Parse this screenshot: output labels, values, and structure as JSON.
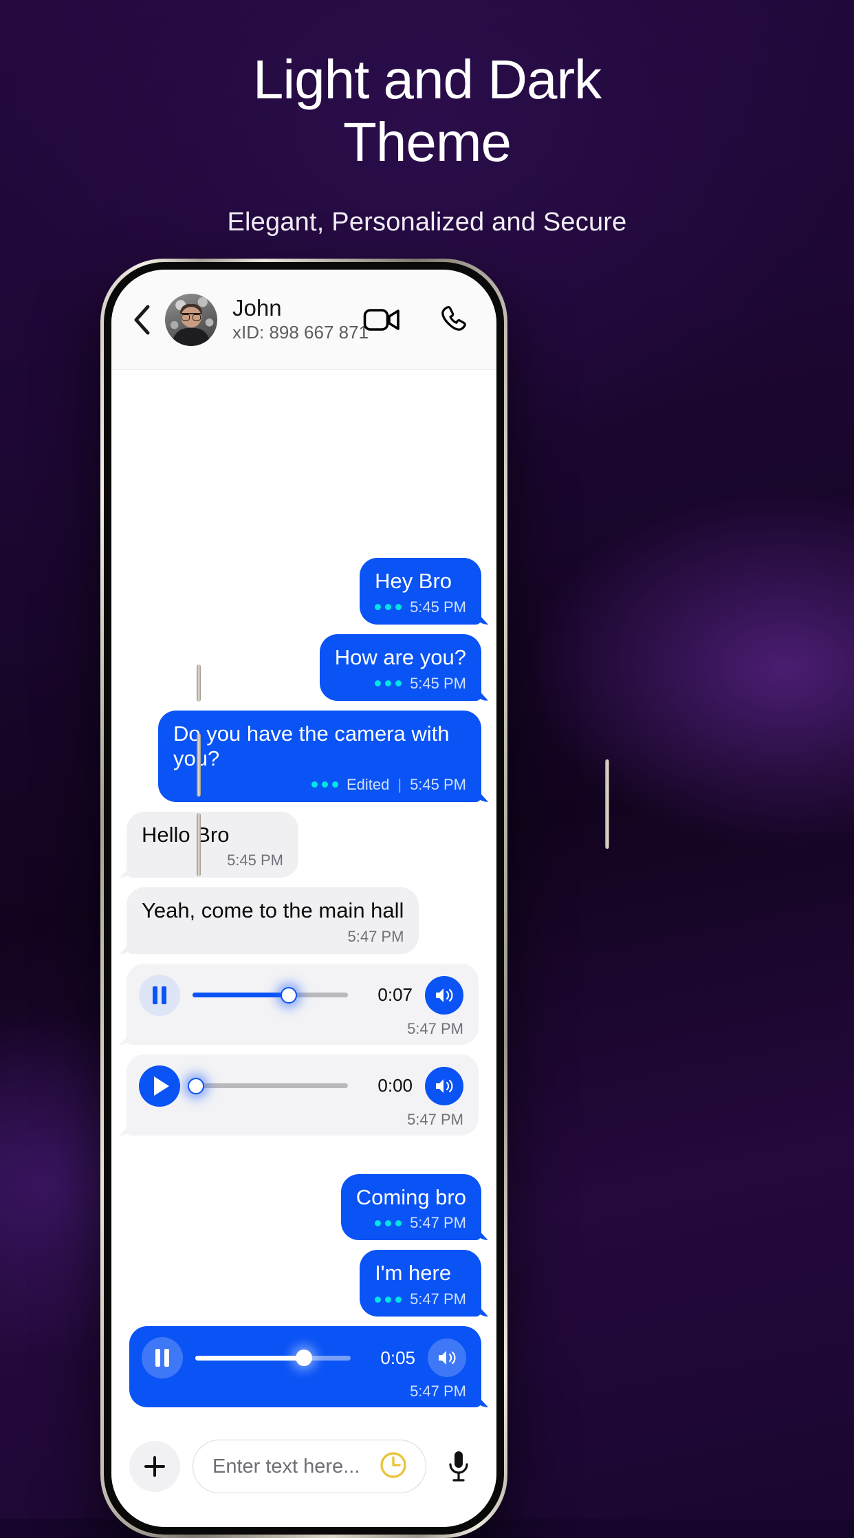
{
  "promo": {
    "headline": "Light and Dark Theme",
    "headline_line1": "Light and Dark",
    "headline_line2": "Theme",
    "subhead": "Elegant, Personalized and Secure"
  },
  "colors": {
    "accent_blue": "#0a53f5",
    "read_dot_cyan": "#00e5e5",
    "bg_purple": "#24093f",
    "header_purple": "#3d0f6e",
    "clock_yellow": "#e8c53a"
  },
  "chat": {
    "header": {
      "back_icon": "chevron-left-icon",
      "avatar_icon": "contact-avatar",
      "name": "John",
      "xid": "xID: 898 667 871",
      "video_icon": "video-camera-icon",
      "call_icon": "phone-icon"
    },
    "messages": [
      {
        "id": "m1",
        "dir": "out",
        "type": "text",
        "text": "Hey Bro",
        "time": "5:45 PM",
        "edited": ""
      },
      {
        "id": "m2",
        "dir": "out",
        "type": "text",
        "text": "How are you?",
        "time": "5:45 PM",
        "edited": ""
      },
      {
        "id": "m3",
        "dir": "out",
        "type": "text",
        "text": "Do you have the camera with you?",
        "time": "5:45 PM",
        "edited": "Edited",
        "sep": "|"
      },
      {
        "id": "m4",
        "dir": "in",
        "type": "text",
        "text": "Hello Bro",
        "time": "5:45 PM",
        "edited": ""
      },
      {
        "id": "m5",
        "dir": "in",
        "type": "text",
        "text": "Yeah, come to the main hall",
        "time": "5:47 PM",
        "edited": ""
      },
      {
        "id": "m6",
        "dir": "in",
        "type": "voice",
        "state": "pause-icon",
        "duration": "0:07",
        "progress": 62,
        "time": "5:47 PM",
        "speaker_icon": "speaker-on-icon"
      },
      {
        "id": "m7",
        "dir": "in",
        "type": "voice",
        "state": "play-icon",
        "duration": "0:00",
        "progress": 0,
        "time": "5:47 PM",
        "speaker_icon": "speaker-on-icon"
      },
      {
        "id": "m8",
        "dir": "out",
        "type": "text",
        "text": "Coming bro",
        "time": "5:47 PM",
        "edited": ""
      },
      {
        "id": "m9",
        "dir": "out",
        "type": "text",
        "text": "I'm here",
        "time": "5:47 PM",
        "edited": ""
      },
      {
        "id": "m10",
        "dir": "out",
        "type": "voice",
        "state": "pause-icon",
        "duration": "0:05",
        "progress": 70,
        "time": "5:47 PM",
        "speaker_icon": "speaker-on-icon"
      }
    ],
    "input": {
      "attach_icon": "plus-icon",
      "placeholder": "Enter text here...",
      "timer_icon": "clock-icon",
      "mic_icon": "microphone-icon"
    }
  }
}
